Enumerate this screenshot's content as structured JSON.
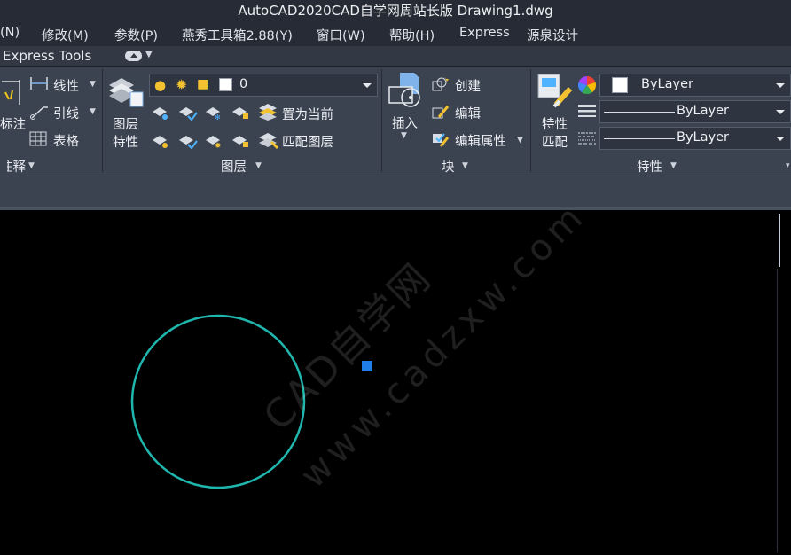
{
  "titlebar": {
    "title": "AutoCAD2020CAD自学网周站长版     Drawing1.dwg"
  },
  "menu": {
    "items": [
      "(N)",
      "修改(M)",
      "参数(P)",
      "燕秀工具箱2.88(Y)",
      "窗口(W)",
      "帮助(H)",
      "Express",
      "源泉设计"
    ]
  },
  "tabs": {
    "active": "Express Tools"
  },
  "ribbon": {
    "annotate": {
      "title": "注释",
      "big_label": "标注",
      "linear": "线性",
      "leader": "引线",
      "table": "表格"
    },
    "layers": {
      "title": "图层",
      "layer_props_line1": "图层",
      "layer_props_line2": "特性",
      "current_layer": "0",
      "make_current": "置为当前",
      "match_layer": "匹配图层"
    },
    "block": {
      "title": "块",
      "insert": "插入",
      "create": "创建",
      "edit": "编辑",
      "edit_attr": "编辑属性"
    },
    "properties": {
      "title": "特性",
      "match_line1": "特性",
      "match_line2": "匹配",
      "color": "ByLayer",
      "linetype": "ByLayer",
      "lineweight": "ByLayer"
    }
  },
  "watermark": {
    "line1": "CAD自学网",
    "line2": "www.cadzxw.com"
  },
  "colors": {
    "accent": "#1f7ee8",
    "circle": "#1fb6ad",
    "ribbon_bg": "#3b4350",
    "title_bg": "#262b35"
  }
}
